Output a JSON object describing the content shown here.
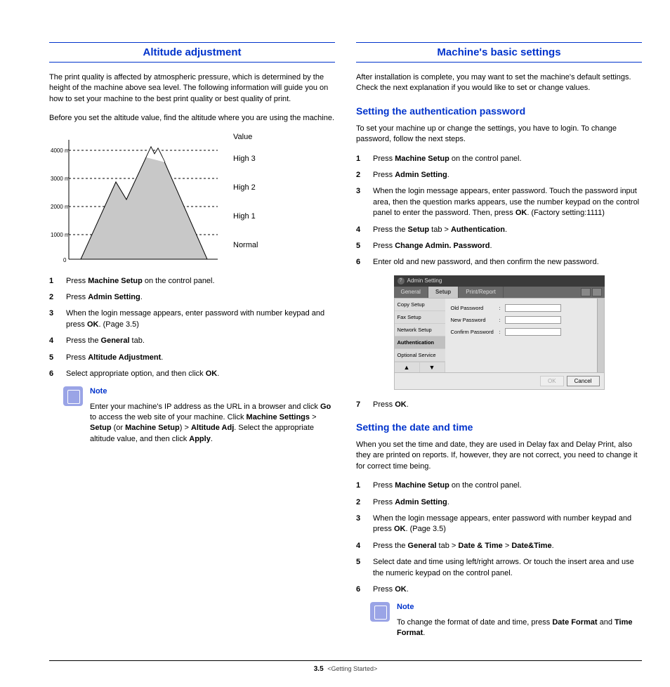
{
  "left": {
    "title": "Altitude adjustment",
    "p1": "The print quality is affected by atmospheric pressure, which is determined by the height of the machine above sea level. The following information will guide you on how to set your machine to the best print quality or best quality of print.",
    "p2": "Before you set the altitude value, find the altitude where you are using the machine.",
    "diagram": {
      "value_header": "Value",
      "levels": [
        "High 3",
        "High 2",
        "High 1",
        "Normal"
      ],
      "alts": [
        "4000 m",
        "3000 m",
        "2000 m",
        "1000 m",
        "0"
      ]
    },
    "steps": [
      {
        "n": "1",
        "pre": "Press ",
        "b": "Machine Setup",
        "post": " on the control panel."
      },
      {
        "n": "2",
        "pre": "Press ",
        "b": "Admin Setting",
        "post": "."
      },
      {
        "n": "3",
        "pre": "When the login message appears, enter password with number keypad and press ",
        "b": "OK",
        "post": ". (Page 3.5)"
      },
      {
        "n": "4",
        "pre": "Press the ",
        "b": "General",
        "post": " tab."
      },
      {
        "n": "5",
        "pre": "Press ",
        "b": "Altitude Adjustment",
        "post": "."
      },
      {
        "n": "6",
        "pre": "Select appropriate option, and then click ",
        "b": "OK",
        "post": "."
      }
    ],
    "note_title": "Note",
    "note_body_parts": {
      "t1": "Enter your machine's IP address as the URL in a browser and click ",
      "b1": "Go",
      "t2": " to access the web site of your machine. Click ",
      "b2": "Machine Settings",
      "t3": " > ",
      "b3": "Setup",
      "t4": " (or ",
      "b4": "Machine Setup",
      "t5": ") > ",
      "b5": "Altitude Adj",
      "t6": ". Select the appropriate altitude value, and then click ",
      "b6": "Apply",
      "t7": "."
    }
  },
  "right": {
    "title": "Machine's basic settings",
    "p1": "After installation is complete, you may want to set the machine's default settings. Check the next explanation if you would like to set or change values.",
    "auth": {
      "title": "Setting the authentication password",
      "p1": "To set your machine up or change the settings, you have to login. To change password, follow the next steps.",
      "steps": [
        {
          "n": "1",
          "pre": "Press ",
          "b": "Machine Setup",
          "post": " on the control panel."
        },
        {
          "n": "2",
          "pre": "Press ",
          "b": "Admin Setting",
          "post": "."
        },
        {
          "n": "3",
          "pre": "When the login message appears, enter password. Touch the password input area, then the question marks appears, use the number keypad on the control panel to enter the password. Then, press ",
          "b": "OK",
          "post": ". (Factory setting:1111)"
        },
        {
          "n": "4",
          "pre": "Press the ",
          "b": "Setup",
          "post_pre": " tab > ",
          "b2": "Authentication",
          "post": "."
        },
        {
          "n": "5",
          "pre": "Press ",
          "b": "Change Admin. Password",
          "post": "."
        },
        {
          "n": "6",
          "pre": "Enter old and new password, and then confirm the new password.",
          "b": "",
          "post": ""
        }
      ],
      "step7": {
        "n": "7",
        "pre": "Press ",
        "b": "OK",
        "post": "."
      }
    },
    "ui": {
      "header": "Admin Setting",
      "tabs": [
        "General",
        "Setup",
        "Print/Report"
      ],
      "side": [
        "Copy Setup",
        "Fax Setup",
        "Network Setup",
        "Authentication",
        "Optional Service"
      ],
      "rows": [
        "Old Password",
        "New Password",
        "Confirm Password"
      ],
      "ok": "OK",
      "cancel": "Cancel"
    },
    "datetime": {
      "title": "Setting the date and time",
      "p1": "When you set the time and date, they are used in Delay fax and Delay Print, also they are printed on reports. If, however, they are not correct, you need to change it for correct time being.",
      "steps": [
        {
          "n": "1",
          "pre": "Press ",
          "b": "Machine Setup",
          "post": " on the control panel."
        },
        {
          "n": "2",
          "pre": "Press ",
          "b": "Admin Setting",
          "post": "."
        },
        {
          "n": "3",
          "pre": "When the login message appears, enter password with number keypad and press ",
          "b": "OK",
          "post": ". (Page 3.5)"
        },
        {
          "n": "4",
          "pre": "Press the ",
          "b": "General",
          "post_pre": " tab > ",
          "b2": "Date & Time",
          "post_pre2": " > ",
          "b3": "Date&Time",
          "post": "."
        },
        {
          "n": "5",
          "pre": "Select date and time using left/right arrows. Or touch the insert area and use the numeric keypad on the control panel.",
          "b": "",
          "post": ""
        },
        {
          "n": "6",
          "pre": "Press ",
          "b": "OK",
          "post": "."
        }
      ],
      "note_title": "Note",
      "note": {
        "t1": "To change the format of date and time, press ",
        "b1": "Date Format",
        "t2": " and ",
        "b2": "Time Format",
        "t3": "."
      }
    }
  },
  "footer": {
    "chapter": "3",
    "page": ".5",
    "label": "<Getting Started>"
  }
}
